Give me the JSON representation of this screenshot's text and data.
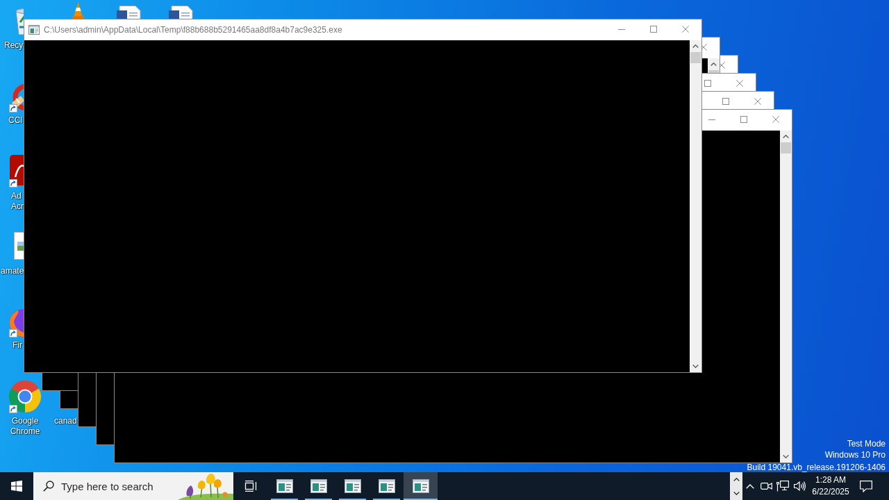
{
  "desktop_icons": [
    {
      "kind": "bin",
      "shortcut": false,
      "label_lines": [
        "Recy"
      ]
    },
    {
      "kind": "cone"
    },
    {
      "kind": "page"
    },
    {
      "kind": "page"
    },
    {
      "kind": "cleaner",
      "shortcut": true,
      "label_lines": [
        "CCl"
      ]
    },
    {
      "kind": "pdf",
      "shortcut": true,
      "label_lines": [
        "Ad",
        "Acr"
      ]
    },
    {
      "kind": "picture",
      "shortcut": false,
      "label_lines": [
        "amate"
      ]
    },
    {
      "kind": "fox",
      "shortcut": true,
      "label_lines": [
        "Fir"
      ]
    },
    {
      "kind": "wheel",
      "shortcut": true,
      "label_lines": [
        "Google",
        "Chrome"
      ]
    },
    {
      "label_lines": [
        "canad"
      ]
    }
  ],
  "windows": [
    {
      "title": "C:\\Users\\admin\\AppData\\Local\\Temp\\f88b688b5291465aa8df8a4b7ac9e325.exe",
      "controls": [
        {
          "kind": "minimize"
        },
        {
          "kind": "maximize"
        },
        {
          "kind": "close"
        }
      ]
    },
    {
      "controls": [
        {
          "kind": "close"
        }
      ]
    },
    {
      "controls": [
        {
          "kind": "close"
        }
      ]
    },
    {
      "controls": [
        {
          "kind": "maximize"
        },
        {
          "kind": "close"
        }
      ]
    },
    {
      "controls": [
        {
          "kind": "maximize"
        },
        {
          "kind": "close"
        }
      ]
    },
    {
      "controls": [
        {
          "kind": "minimize"
        },
        {
          "kind": "maximize"
        },
        {
          "kind": "close"
        }
      ]
    }
  ],
  "system_notice_lines": [
    "Test Mode",
    "Windows 10 Pro",
    "Build 19041.vb_release.191206-1406"
  ],
  "taskbar": {
    "search": {
      "placeholder": "Type here to search"
    },
    "apps": [
      {
        "selected": false
      },
      {
        "selected": false
      },
      {
        "selected": false
      },
      {
        "selected": false
      },
      {
        "selected": true
      }
    ],
    "clock": {
      "time": "1:28 AM",
      "date": "6/22/2025"
    }
  }
}
